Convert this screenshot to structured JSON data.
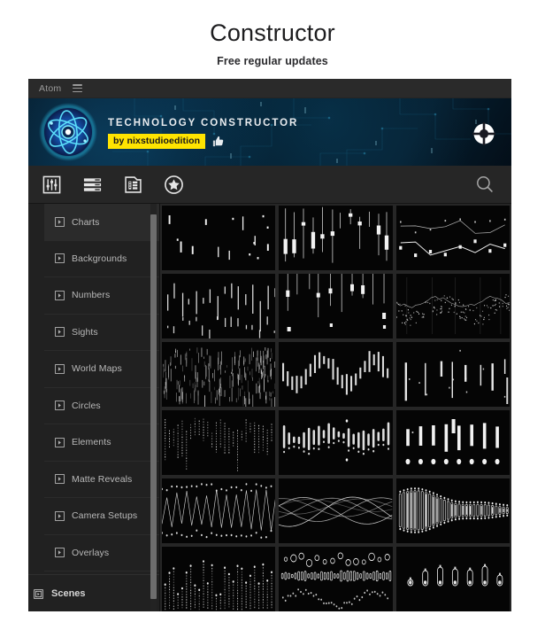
{
  "page": {
    "title": "Constructor",
    "subtitle": "Free regular updates"
  },
  "app": {
    "menu": {
      "app_name": "Atom",
      "hamburger_icon": "hamburger-menu-icon"
    },
    "banner": {
      "title": "TECHNOLOGY CONSTRUCTOR",
      "badge": "by nixstudioedition",
      "thumb_up_icon": "thumbs-up-icon",
      "logo_icon": "atom-logo-icon",
      "target_icon": "target-ring-icon",
      "badge_bg": "#ffe400",
      "badge_text_color": "#17171a"
    },
    "toolbar": {
      "items": [
        {
          "icon": "sliders-icon",
          "label": "Sliders"
        },
        {
          "icon": "list-layers-icon",
          "label": "Layers"
        },
        {
          "icon": "film-document-icon",
          "label": "Compositions"
        },
        {
          "icon": "star-circle-icon",
          "label": "Favorites"
        }
      ],
      "search_icon": "search-icon"
    },
    "sidebar": {
      "items": [
        {
          "label": "Charts",
          "icon": "expand-square-icon",
          "selected": true
        },
        {
          "label": "Backgrounds",
          "icon": "expand-square-icon",
          "selected": false
        },
        {
          "label": "Numbers",
          "icon": "expand-square-icon",
          "selected": false
        },
        {
          "label": "Sights",
          "icon": "expand-square-icon",
          "selected": false
        },
        {
          "label": "World Maps",
          "icon": "expand-square-icon",
          "selected": false
        },
        {
          "label": "Circles",
          "icon": "expand-square-icon",
          "selected": false
        },
        {
          "label": "Elements",
          "icon": "expand-square-icon",
          "selected": false
        },
        {
          "label": "Matte Reveals",
          "icon": "expand-square-icon",
          "selected": false
        },
        {
          "label": "Camera Setups",
          "icon": "expand-square-icon",
          "selected": false
        },
        {
          "label": "Overlays",
          "icon": "expand-square-icon",
          "selected": false
        }
      ],
      "footer": {
        "label": "Scenes",
        "icon": "scenes-square-icon"
      },
      "scrollbar": {
        "name": "sidebar-scrollbar"
      }
    },
    "grid": {
      "columns": 3,
      "thumbnails": [
        {
          "id": "thumb-1",
          "kind": "sparse-bars-dots"
        },
        {
          "id": "thumb-2",
          "kind": "tall-candles"
        },
        {
          "id": "thumb-3",
          "kind": "dual-line-nodes"
        },
        {
          "id": "thumb-4",
          "kind": "drop-bars"
        },
        {
          "id": "thumb-5",
          "kind": "hanging-candles"
        },
        {
          "id": "thumb-6",
          "kind": "dotted-scatter-lines"
        },
        {
          "id": "thumb-7",
          "kind": "dense-dashes"
        },
        {
          "id": "thumb-8",
          "kind": "candle-wave"
        },
        {
          "id": "thumb-9",
          "kind": "sparse-tall-bars"
        },
        {
          "id": "thumb-10",
          "kind": "dotted-columns"
        },
        {
          "id": "thumb-11",
          "kind": "capsule-row"
        },
        {
          "id": "thumb-12",
          "kind": "bars-with-dots"
        },
        {
          "id": "thumb-13",
          "kind": "zigzag-dots"
        },
        {
          "id": "thumb-14",
          "kind": "smooth-waves"
        },
        {
          "id": "thumb-15",
          "kind": "capsule-cluster"
        },
        {
          "id": "thumb-16",
          "kind": "dotted-bars-dots"
        },
        {
          "id": "thumb-17",
          "kind": "circles-scatter"
        },
        {
          "id": "thumb-18",
          "kind": "pill-row"
        }
      ]
    }
  },
  "colors": {
    "app_bg": "#1c1c1c",
    "sidebar_bg": "#212121",
    "toolbar_bg": "#262626",
    "grid_bg": "#262626",
    "thumb_bg": "#050505",
    "accent_yellow": "#ffe400",
    "text_muted": "#b9b9b9"
  }
}
